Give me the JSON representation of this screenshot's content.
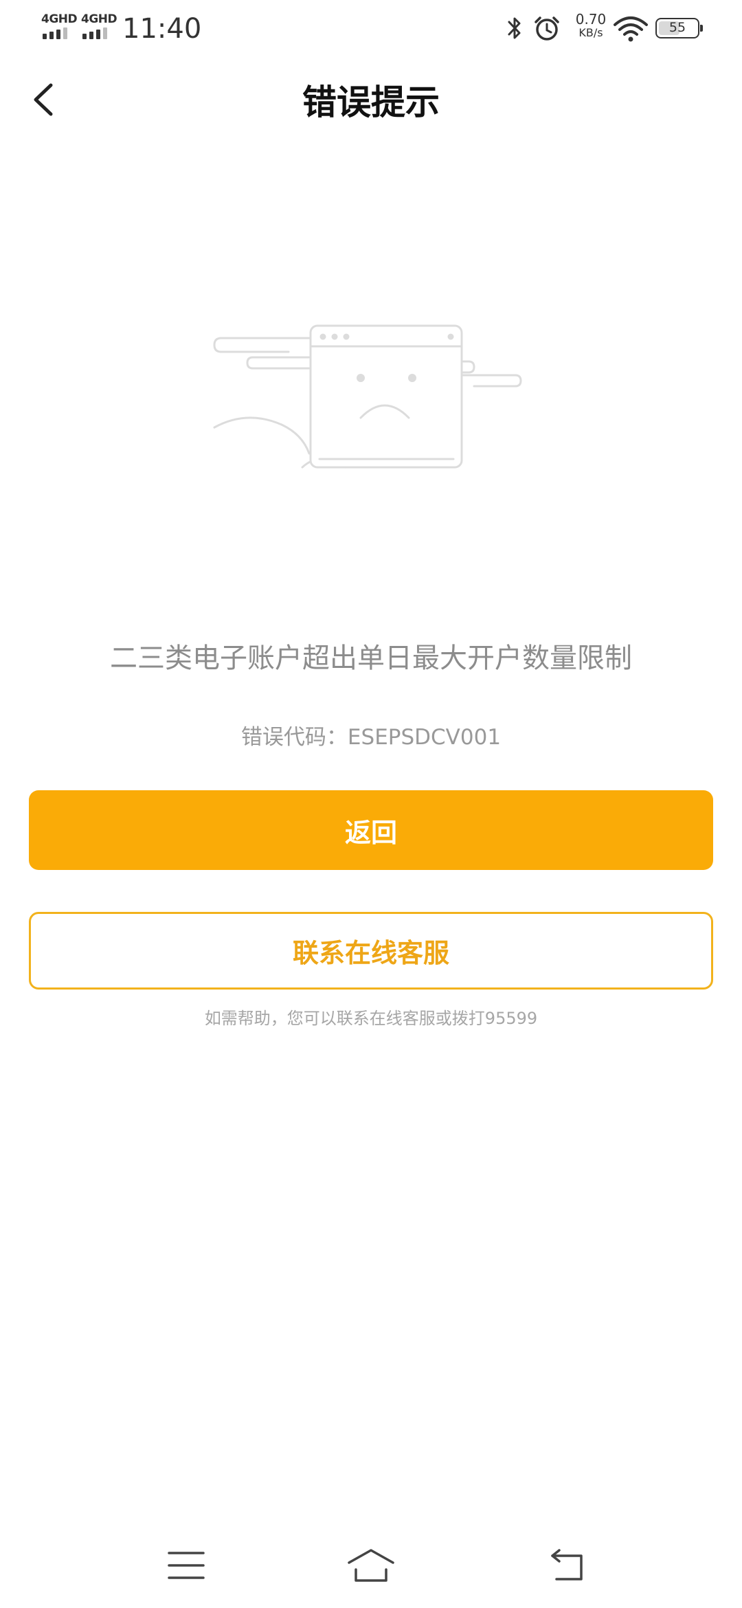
{
  "status_bar": {
    "network_1": "4GHD",
    "network_2": "4GHD",
    "time": "11:40",
    "speed_value": "0.70",
    "speed_unit": "KB/s",
    "battery_level": "55",
    "icons": [
      "signal-icon",
      "bluetooth-icon",
      "alarm-icon",
      "wifi-icon",
      "battery-icon"
    ]
  },
  "nav": {
    "title": "错误提示",
    "back_icon": "chevron-left-icon"
  },
  "illustration": {
    "icon": "sad-window-icon"
  },
  "error": {
    "message": "二三类电子账户超出单日最大开户数量限制",
    "code_text": "错误代码：ESEPSDCV001"
  },
  "actions": {
    "return_label": "返回",
    "contact_label": "联系在线客服",
    "help_text": "如需帮助，您可以联系在线客服或拨打95599"
  },
  "system_nav": {
    "icons": [
      "menu-icon",
      "home-icon",
      "back-arrow-icon"
    ]
  },
  "colors": {
    "accent": "#faab07",
    "outline": "#f2b21c",
    "muted_text": "#8c8c8c"
  }
}
